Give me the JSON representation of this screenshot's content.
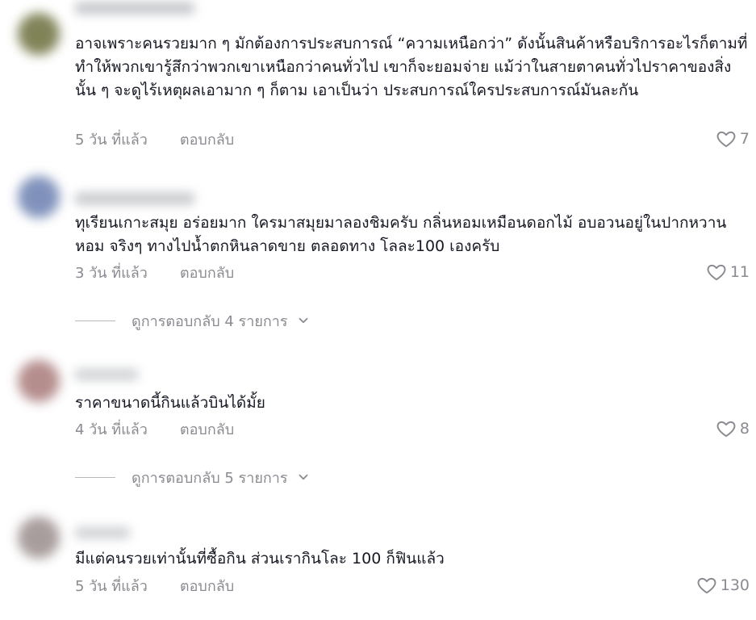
{
  "comments": [
    {
      "avatar_color": "#6b6e3c",
      "text": "อาจเพราะคนรวยมาก ๆ มักต้องการประสบการณ์ “ความเหนือกว่า” ดังนั้นสินค้าหรือบริการอะไรก็ตามที่ทำให้พวกเขารู้สึกว่าพวกเขาเหนือกว่าคนทั่วไป เขาก็จะยอมจ่าย แม้ว่าในสายตาคนทั่วไปราคาของสิ่งนั้น ๆ จะดูไร้เหตุผลเอามาก ๆ ก็ตาม เอาเป็นว่า ประสบการณ์ใครประสบการณ์มันละกัน",
      "time": "5 วัน ที่แล้ว",
      "reply_label": "ตอบกลับ",
      "likes": "7"
    },
    {
      "avatar_color": "#6b7fb0",
      "text": "ทุเรียนเกาะสมุย อร่อยมาก ใครมาสมุยมาลองชิมครับ กลิ่นหอมเหมือนดอกไม้ อบอวนอยู่ในปากหวานหอม จริงๆ ทางไปน้ำตกหินลาดขาย ตลอดทาง โลละ100 เองครับ",
      "time": "3 วัน ที่แล้ว",
      "reply_label": "ตอบกลับ",
      "likes": "11",
      "view_replies": "ดูการตอบกลับ 4 รายการ"
    },
    {
      "avatar_color": "#a87a7a",
      "text": "ราคาขนาดนี้กินแล้วบินได้มั้ย",
      "time": "4 วัน ที่แล้ว",
      "reply_label": "ตอบกลับ",
      "likes": "8",
      "view_replies": "ดูการตอบกลับ 5 รายการ"
    },
    {
      "avatar_color": "#9a8c8c",
      "text": "มีแต่คนรวยเท่านั้นที่ซื้อกิน ส่วนเรากินโละ 100 ก็ฟินแล้ว",
      "time": "5 วัน ที่แล้ว",
      "reply_label": "ตอบกลับ",
      "likes": "130"
    }
  ],
  "colors": {
    "text": "#161823",
    "muted": "#8a8b91"
  },
  "icons": {
    "like": "heart-outline-icon",
    "expand": "chevron-down-icon"
  }
}
